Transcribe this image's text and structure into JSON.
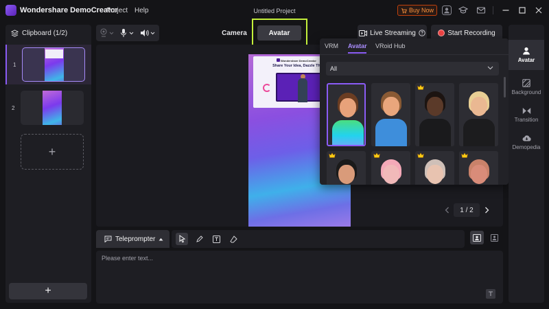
{
  "app": {
    "name": "Wondershare DemoCreator",
    "menu": [
      "Project",
      "Help"
    ],
    "document_title": "Untitled Project",
    "buy_now_label": "Buy Now"
  },
  "clipboard": {
    "title": "Clipboard (1/2)",
    "clips": [
      {
        "number": "1",
        "selected": true
      },
      {
        "number": "2",
        "selected": false
      }
    ],
    "add_symbol": "+"
  },
  "toolbar": {
    "camera_label": "Camera",
    "avatar_label": "Avatar",
    "live_streaming_label": "Live Streaming",
    "start_recording_label": "Start Recording"
  },
  "preview": {
    "slide_brand": "Wondershare DemoCreator",
    "slide_heading": "Share Your Idea, Dazzle The W...",
    "pager_label": "1 / 2"
  },
  "avatar_panel": {
    "tabs": [
      "VRM",
      "Avatar",
      "VRoid Hub"
    ],
    "active_tab": "Avatar",
    "filter_value": "All",
    "avatars": [
      {
        "premium": false,
        "selected": true,
        "skin": "#e8a27a",
        "hair": "#6b3d22",
        "shirt": "gradient"
      },
      {
        "premium": false,
        "selected": false,
        "skin": "#e9a67c",
        "hair": "#8a5a34",
        "shirt": "#3e8edb"
      },
      {
        "premium": true,
        "selected": false,
        "skin": "#5b3a29",
        "hair": "#1c1411",
        "shirt": "#1a1a1c"
      },
      {
        "premium": false,
        "selected": false,
        "skin": "#eab892",
        "hair": "#e9cf95",
        "shirt": "#1c1c1e"
      },
      {
        "premium": true,
        "selected": false,
        "skin": "#d99b7a",
        "hair": "#1a1a1a",
        "shirt": "#333"
      },
      {
        "premium": true,
        "selected": false,
        "skin": "#f1b9b9",
        "hair": "#f4a9b8",
        "shirt": "#333"
      },
      {
        "premium": true,
        "selected": false,
        "skin": "#e8c3b0",
        "hair": "#cfc0b8",
        "shirt": "#333"
      },
      {
        "premium": true,
        "selected": false,
        "skin": "#d98c79",
        "hair": "#c9826a",
        "shirt": "#333"
      }
    ]
  },
  "teleprompter": {
    "tab_label": "Teleprompter",
    "placeholder": "Please enter text..."
  },
  "sidebar": {
    "items": [
      {
        "label": "Avatar",
        "icon": "person-icon"
      },
      {
        "label": "Background",
        "icon": "background-icon"
      },
      {
        "label": "Transition",
        "icon": "transition-icon"
      },
      {
        "label": "Demopedia",
        "icon": "cloud-icon"
      }
    ]
  },
  "colors": {
    "accent": "#8b5cf6",
    "highlight": "#c4f03b",
    "record": "#ef4444",
    "buy_now": "#fb923c"
  }
}
